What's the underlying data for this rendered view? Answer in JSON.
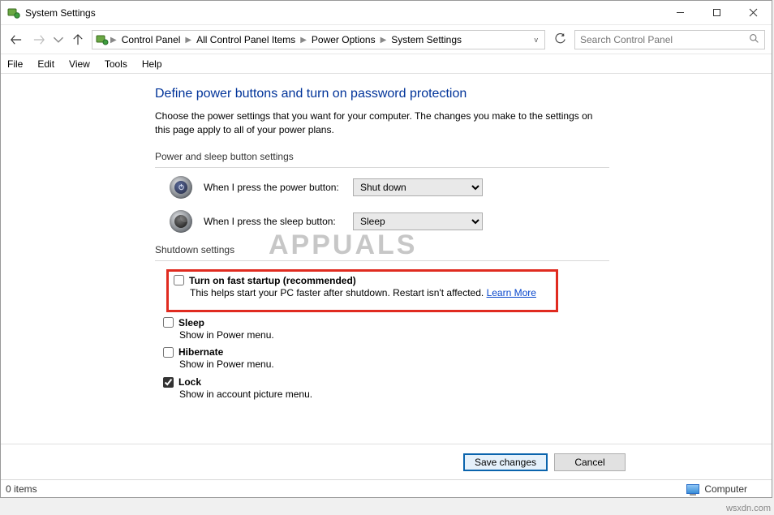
{
  "window": {
    "title": "System Settings"
  },
  "breadcrumb": {
    "items": [
      "Control Panel",
      "All Control Panel Items",
      "Power Options",
      "System Settings"
    ]
  },
  "search": {
    "placeholder": "Search Control Panel"
  },
  "menubar": [
    "File",
    "Edit",
    "View",
    "Tools",
    "Help"
  ],
  "page": {
    "heading": "Define power buttons and turn on password protection",
    "intro": "Choose the power settings that you want for your computer. The changes you make to the settings on this page apply to all of your power plans.",
    "section1_title": "Power and sleep button settings",
    "power_button_label": "When I press the power button:",
    "power_button_value": "Shut down",
    "sleep_button_label": "When I press the sleep button:",
    "sleep_button_value": "Sleep",
    "section2_title": "Shutdown settings",
    "fast_startup_label": "Turn on fast startup (recommended)",
    "fast_startup_desc": "This helps start your PC faster after shutdown. Restart isn't affected. ",
    "learn_more": "Learn More",
    "sleep_label": "Sleep",
    "sleep_desc": "Show in Power menu.",
    "hibernate_label": "Hibernate",
    "hibernate_desc": "Show in Power menu.",
    "lock_label": "Lock",
    "lock_desc": "Show in account picture menu."
  },
  "buttons": {
    "save": "Save changes",
    "cancel": "Cancel"
  },
  "statusbar": {
    "items": "0 items",
    "location": "Computer"
  },
  "watermark": "APPUALS",
  "source": "wsxdn.com"
}
